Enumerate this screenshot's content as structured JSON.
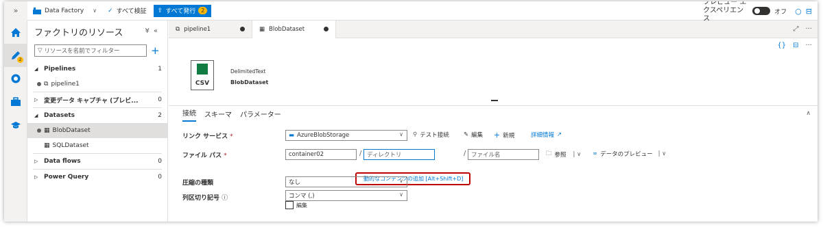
{
  "topbar": {
    "expand": "»",
    "factory_name": "Data Factory",
    "validate_all": "すべて検証",
    "publish_all": "すべて発行",
    "publish_count": "2",
    "preview_label": "プレビュー エクスペリエンス",
    "toggle_state": "オフ"
  },
  "rail": {
    "pending_badge": "2"
  },
  "resources": {
    "title": "ファクトリのリソース",
    "filter_placeholder": "リソースを名前でフィルター",
    "pipelines": {
      "label": "Pipelines",
      "count": "1",
      "items": [
        "pipeline1"
      ]
    },
    "cdc": {
      "label": "変更データ キャプチャ (プレビ...",
      "count": "0"
    },
    "datasets": {
      "label": "Datasets",
      "count": "2",
      "items": [
        "BlobDataset",
        "SQLDataset"
      ]
    },
    "dataflows": {
      "label": "Data flows",
      "count": "0"
    },
    "powerquery": {
      "label": "Power Query",
      "count": "0"
    }
  },
  "tabs": [
    {
      "label": "pipeline1"
    },
    {
      "label": "BlobDataset"
    }
  ],
  "dataset": {
    "icon_label": "CSV",
    "type": "DelimitedText",
    "name": "BlobDataset"
  },
  "prop_tabs": [
    "接続",
    "スキーマ",
    "パラメーター"
  ],
  "form": {
    "linked_service_label": "リンク サービス",
    "linked_service_value": "AzureBlobStorage",
    "test_connection": "テスト接続",
    "edit": "編集",
    "new": "新規",
    "details": "詳細情報",
    "file_path_label": "ファイル パス",
    "container": "container02",
    "directory_placeholder": "ディレクトリ",
    "filename_placeholder": "ファイル名",
    "browse": "参照",
    "preview_data": "データのプレビュー",
    "dynamic_content": "動的なコンテンツの追加 [Alt+Shift+D]",
    "compression_label": "圧縮の種類",
    "compression_value": "なし",
    "delimiter_label": "列区切り記号",
    "delimiter_value": "コンマ (,)",
    "edit_checkbox": "編集",
    "required_mark": "*"
  }
}
